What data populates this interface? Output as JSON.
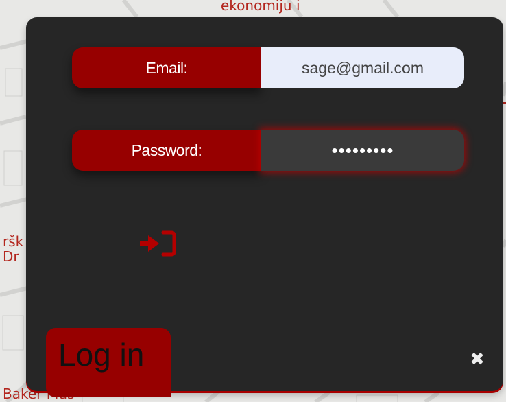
{
  "map": {
    "labels": [
      "ekonomiju i",
      "ršk",
      "Dr",
      "Baker Plus"
    ]
  },
  "form": {
    "email": {
      "label": "Email:",
      "value": "sage@gmail.com"
    },
    "password": {
      "label": "Password:",
      "value": "•••••••••"
    }
  },
  "login_tab": {
    "label": "Log in"
  },
  "icons": {
    "submit": "sign-in-icon",
    "close": "close-icon",
    "close_glyph": "✖"
  },
  "colors": {
    "accent": "#970000",
    "modal_bg": "#262626",
    "email_input_bg": "#e8edfa",
    "password_input_bg": "#3a3a3a"
  }
}
